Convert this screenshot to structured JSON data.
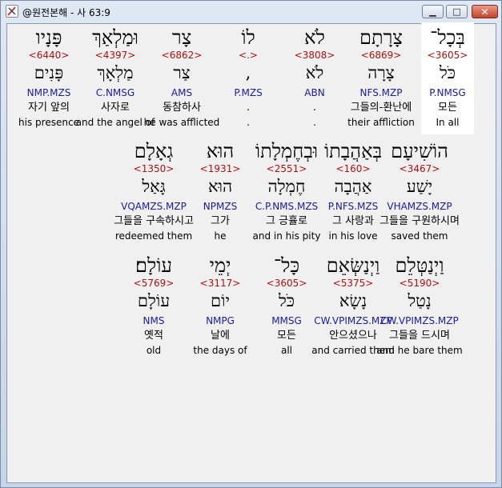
{
  "window": {
    "title": "@원전본해 - 사 63:9",
    "controls": {
      "minimize": "▁",
      "maximize": "□",
      "close": "✕"
    }
  },
  "verse": {
    "rows": [
      {
        "words": [
          {
            "hebrew": "בְּכָל־",
            "strong": "<3605>",
            "lemma": "כֹּל",
            "morph": "P.NMSG",
            "korean": "모든",
            "english": "In all",
            "selected": true
          },
          {
            "hebrew": "צָרָתָם",
            "strong": "<6869>",
            "lemma": "צָרָה",
            "morph": "NFS.MZP",
            "korean": "그들의-환난에",
            "english": "their affliction"
          },
          {
            "hebrew": "לֹא",
            "strong": "<3808>",
            "lemma": "לֹא",
            "morph": "ABN",
            "korean": ".",
            "english": "."
          },
          {
            "hebrew": "לוֹ",
            "strong": "<.>",
            "lemma": ",",
            "morph": "P.MZS",
            "korean": ".",
            "english": "."
          },
          {
            "hebrew": "צָר",
            "strong": "<6862>",
            "lemma": "צַר",
            "morph": "AMS",
            "korean": "동참하사",
            "english": "he was afflicted"
          },
          {
            "hebrew": "וּמַלְאַךְ",
            "strong": "<4397>",
            "lemma": "מַלְאָךְ",
            "morph": "C.NMSG",
            "korean": "사자로",
            "english": "and the angel of"
          },
          {
            "hebrew": "פָּנָיו",
            "strong": "<6440>",
            "lemma": "פָּנִים",
            "morph": "NMP.MZS",
            "korean": "자기 앞의",
            "english": "his presence"
          }
        ]
      },
      {
        "words": [
          {
            "hebrew": "הוֹשִׁיעָם",
            "strong": "<3467>",
            "lemma": "יָשַׁע",
            "morph": "VHAMZS.MZP",
            "korean": "그들을 구원하시며",
            "english": "saved them"
          },
          {
            "hebrew": "בְּאַהֲבָתוֹ",
            "strong": "<160>",
            "lemma": "אַהֲבָה",
            "morph": "P.NFS.MZS",
            "korean": "그 사랑과",
            "english": "in his love"
          },
          {
            "hebrew": "וּבְחֶמְלָתוֹ",
            "strong": "<2551>",
            "lemma": "חֶמְלָה",
            "morph": "C.P.NMS.MZS",
            "korean": "그 긍휼로",
            "english": "and in his pity"
          },
          {
            "hebrew": "הוּא",
            "strong": "<1931>",
            "lemma": "הוּא",
            "morph": "NPMZS",
            "korean": "그가",
            "english": "he"
          },
          {
            "hebrew": "גְאָלָם",
            "strong": "<1350>",
            "lemma": "גָּאַל",
            "morph": "VQAMZS.MZP",
            "korean": "그들을 구속하시고",
            "english": "redeemed them"
          }
        ]
      },
      {
        "words": [
          {
            "hebrew": "וַיְנַטְּלֵם",
            "strong": "<5190>",
            "lemma": "נָטַל",
            "morph": "CW.VPIMZS.MZP",
            "korean": "그들을 드시며",
            "english": "and he bare them"
          },
          {
            "hebrew": "וַיְנַשְּׂאֵם",
            "strong": "<5375>",
            "lemma": "נָשָׂא",
            "morph": "CW.VPIMZS.MZP",
            "korean": "안으셨으나",
            "english": "and carried them"
          },
          {
            "hebrew": "כָּל־",
            "strong": "<3605>",
            "lemma": "כֹּל",
            "morph": "MMSG",
            "korean": "모든",
            "english": "all"
          },
          {
            "hebrew": "יְמֵי",
            "strong": "<3117>",
            "lemma": "יוֹם",
            "morph": "NMPG",
            "korean": "날에",
            "english": "the days of"
          },
          {
            "hebrew": "עוֹלָם׃",
            "strong": "<5769>",
            "lemma": "עוֹלָם",
            "morph": "NMS",
            "korean": "옛적",
            "english": "old"
          }
        ]
      }
    ]
  }
}
